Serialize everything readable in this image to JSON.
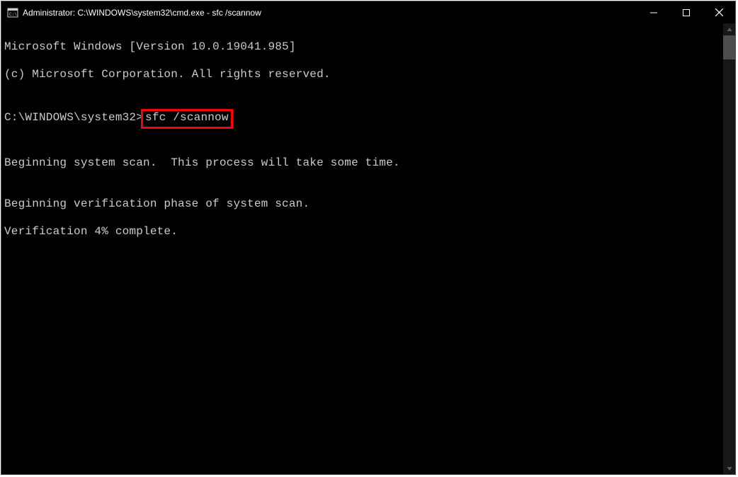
{
  "window": {
    "title": "Administrator: C:\\WINDOWS\\system32\\cmd.exe - sfc  /scannow"
  },
  "terminal": {
    "line1": "Microsoft Windows [Version 10.0.19041.985]",
    "line2": "(c) Microsoft Corporation. All rights reserved.",
    "blank1": "",
    "prompt_prefix": "C:\\WINDOWS\\system32>",
    "command": "sfc /scannow",
    "blank2": "",
    "line3": "Beginning system scan.  This process will take some time.",
    "blank3": "",
    "line4": "Beginning verification phase of system scan.",
    "line5": "Verification 4% complete."
  }
}
